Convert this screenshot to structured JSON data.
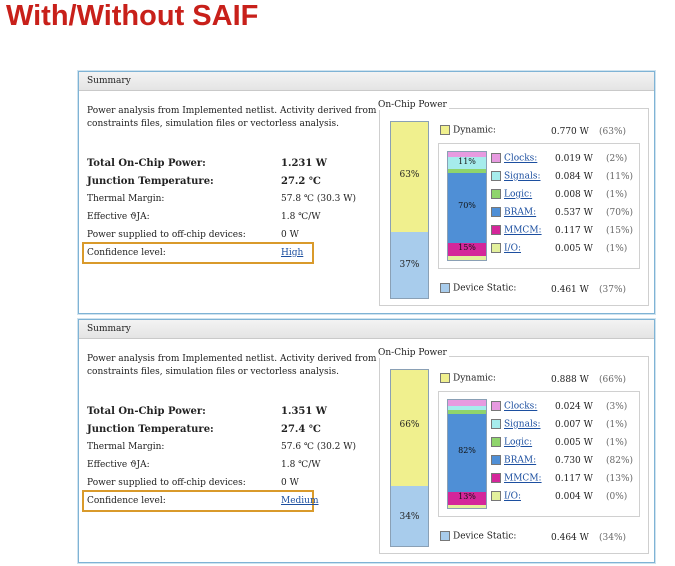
{
  "slide_title": "With/Without SAIF",
  "panels": [
    {
      "header": "Summary",
      "description": "Power analysis from Implemented netlist. Activity derived from constraints files, simulation files or vectorless analysis.",
      "rows": {
        "total_label": "Total On-Chip Power:",
        "total_value": "1.231 W",
        "junction_label": "Junction Temperature:",
        "junction_value": "27.2 ℃",
        "thermal_label": "Thermal Margin:",
        "thermal_value": "57.8 ℃ (30.3 W)",
        "theta_label": "Effective ϑJA:",
        "theta_value": "1.8 ℃/W",
        "offchip_label": "Power supplied to off-chip devices:",
        "offchip_value": "0 W",
        "confidence_label": "Confidence level:",
        "confidence_value": "High"
      },
      "chart": {
        "title": "On-Chip Power",
        "dynamic_pct_bar": "63%",
        "static_pct_bar": "37%",
        "dynamic_label": "Dynamic:",
        "dynamic_value": "0.770 W",
        "dynamic_pct": "(63%)",
        "static_label": "Device Static:",
        "static_value": "0.461 W",
        "static_pct": "(37%)",
        "seg_labels": {
          "clocks": "11%",
          "bram": "70%",
          "mmcm": "15%"
        },
        "items": [
          {
            "label": "Clocks:",
            "value": "0.019 W",
            "pct": "(2%)",
            "color": "#e79ae0"
          },
          {
            "label": "Signals:",
            "value": "0.084 W",
            "pct": "(11%)",
            "color": "#a6ecec"
          },
          {
            "label": "Logic:",
            "value": "0.008 W",
            "pct": "(1%)",
            "color": "#8fd46c"
          },
          {
            "label": "BRAM:",
            "value": "0.537 W",
            "pct": "(70%)",
            "color": "#4f8fd6"
          },
          {
            "label": "MMCM:",
            "value": "0.117 W",
            "pct": "(15%)",
            "color": "#d4269a"
          },
          {
            "label": "I/O:",
            "value": "0.005 W",
            "pct": "(1%)",
            "color": "#e3f09c"
          }
        ],
        "dynamic_color": "#f0f08e",
        "static_color": "#a8ccec",
        "dynamic_fraction": 0.63
      }
    },
    {
      "header": "Summary",
      "description": "Power analysis from Implemented netlist. Activity derived from constraints files, simulation files or vectorless analysis.",
      "rows": {
        "total_label": "Total On-Chip Power:",
        "total_value": "1.351 W",
        "junction_label": "Junction Temperature:",
        "junction_value": "27.4 ℃",
        "thermal_label": "Thermal Margin:",
        "thermal_value": "57.6 ℃ (30.2 W)",
        "theta_label": "Effective ϑJA:",
        "theta_value": "1.8 ℃/W",
        "offchip_label": "Power supplied to off-chip devices:",
        "offchip_value": "0 W",
        "confidence_label": "Confidence level:",
        "confidence_value": "Medium"
      },
      "chart": {
        "title": "On-Chip Power",
        "dynamic_pct_bar": "66%",
        "static_pct_bar": "34%",
        "dynamic_label": "Dynamic:",
        "dynamic_value": "0.888 W",
        "dynamic_pct": "(66%)",
        "static_label": "Device Static:",
        "static_value": "0.464 W",
        "static_pct": "(34%)",
        "seg_labels": {
          "bram": "82%",
          "mmcm": "13%"
        },
        "items": [
          {
            "label": "Clocks:",
            "value": "0.024 W",
            "pct": "(3%)",
            "color": "#e79ae0"
          },
          {
            "label": "Signals:",
            "value": "0.007 W",
            "pct": "(1%)",
            "color": "#a6ecec"
          },
          {
            "label": "Logic:",
            "value": "0.005 W",
            "pct": "(1%)",
            "color": "#8fd46c"
          },
          {
            "label": "BRAM:",
            "value": "0.730 W",
            "pct": "(82%)",
            "color": "#4f8fd6"
          },
          {
            "label": "MMCM:",
            "value": "0.117 W",
            "pct": "(13%)",
            "color": "#d4269a"
          },
          {
            "label": "I/O:",
            "value": "0.004 W",
            "pct": "(0%)",
            "color": "#e3f09c"
          }
        ],
        "dynamic_color": "#f0f08e",
        "static_color": "#a8ccec",
        "dynamic_fraction": 0.66
      }
    }
  ]
}
